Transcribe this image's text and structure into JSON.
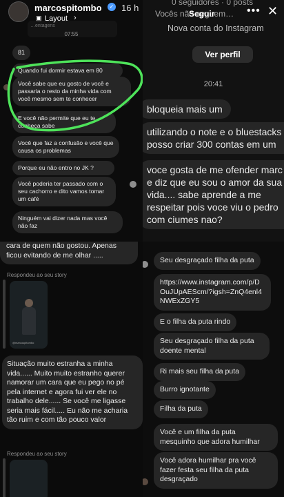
{
  "header": {
    "username": "marcospitombo",
    "time_ago": "16 h",
    "layout_label": "Layout",
    "follow_label": "Seguir",
    "more_icon": "more-icon",
    "close_icon": "close-icon",
    "music_snippet": "…entagens"
  },
  "left_chat": {
    "timestamp": "07:55",
    "messages": [
      "81",
      "Quando fui dormir estava em 80",
      "Você sabe que eu gosto de você e passaria o resto da minha vida com você mesmo sem te conhecer",
      "E você não permite que eu te conheça sabe",
      "Você que faz a confusão e você que causa os problemas",
      "Porque eu não entro no JK ?",
      "Você poderia ter passado com o seu cachorro e dito vamos tomar um café",
      "Ninguém vai dizer nada mas você não faz"
    ],
    "highlight_color": "#4ee35a"
  },
  "right_top": {
    "stats": "0 seguidores · 0 posts",
    "subtitle_partial": "Vocês não seguem…",
    "new_account_label": "Nova conta do Instagram",
    "view_profile_button": "Ver perfil",
    "timestamp": "20:41",
    "messages": [
      "bloqueia mais um",
      "utilizando o note e o bluestacks posso criar 300 contas em um",
      "voce gosta de me ofender marc e diz que eu sou o amor da sua vida.... sabe aprende a me respeitar pois voce viu o pedro com ciumes nao?"
    ]
  },
  "bottom_left": {
    "partial_text": "cara de quem não gostou. Apenas ficou evitando de me olhar .....",
    "replied_label": "Respondeu ao seu story",
    "story_watermark": "@marcospitombo",
    "message": "Situação muito estranha a minha vida...... Muito muito estranho querer namorar um cara que eu pego no pé pela internet e agora fui ver ele no trabalho dele...... Se você me ligasse seria mais fácil..... Eu não me acharia tão ruim e com tão pouco valor",
    "replied_label_2": "Respondeu ao seu story"
  },
  "bottom_right": {
    "messages": [
      "Seu desgraçado filha da puta",
      "https://www.instagram.com/p/DOuJUpAEScm/?igsh=ZnQ4enl4NWExZGY5",
      "E o filha da puta rindo",
      "Seu desgraçado filha da puta doente mental",
      "Ri mais seu filha da puta",
      "Burro ignotante",
      "Filha da puta",
      "Você e um filha da puta mesquinho que adora humilhar",
      "Você adora humilhar pra você fazer festa seu filha da puta desgraçado"
    ]
  }
}
